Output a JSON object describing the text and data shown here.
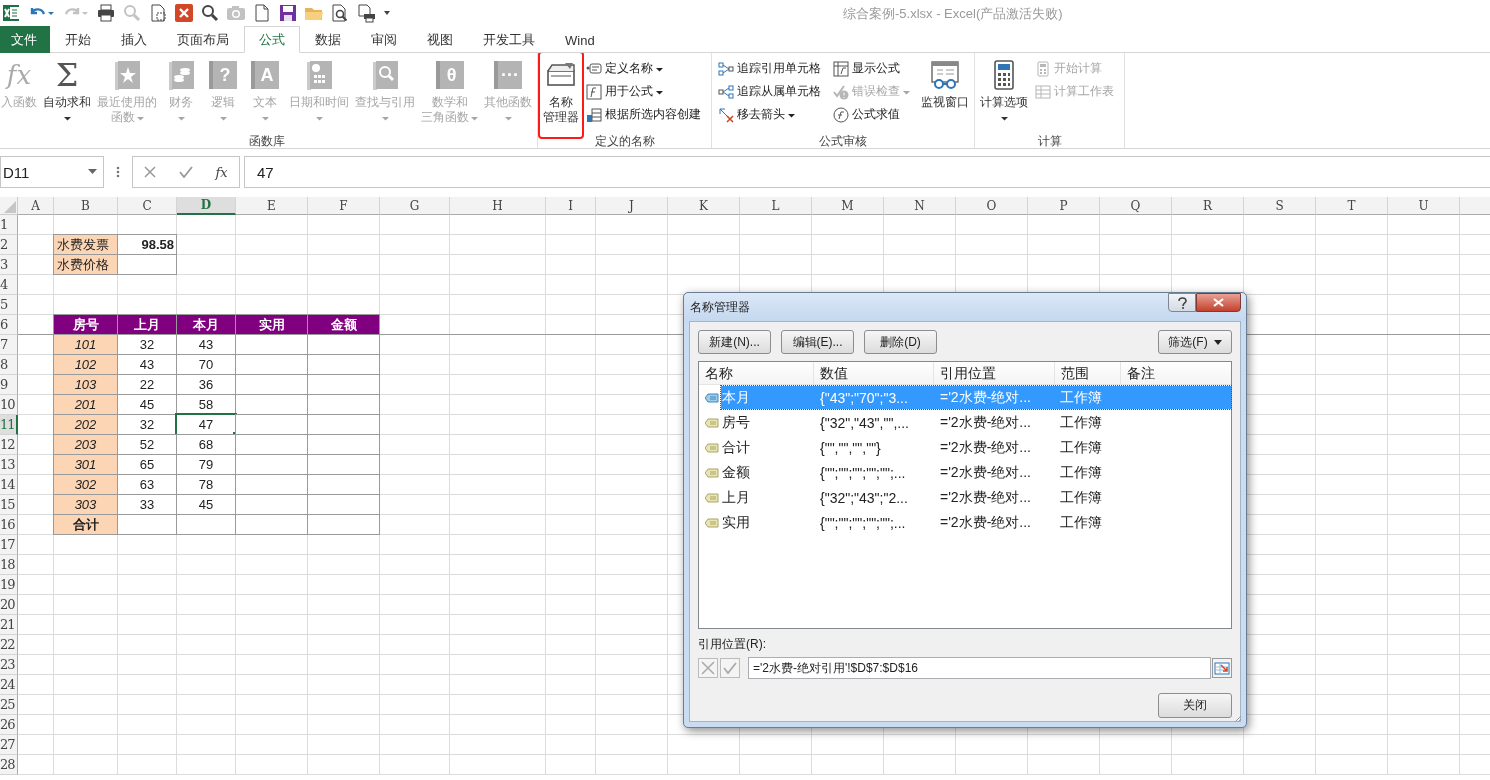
{
  "window": {
    "title": "综合案例-5.xlsx - Excel(产品激活失败)"
  },
  "quick_access": [
    {
      "disabled": false,
      "dropdown": false
    },
    {
      "disabled": false,
      "dropdown": true
    },
    {
      "disabled": true,
      "dropdown": true
    },
    {
      "disabled": false,
      "dropdown": false
    },
    {
      "disabled": true,
      "dropdown": false
    },
    {
      "disabled": false,
      "dropdown": false
    },
    {
      "disabled": false,
      "dropdown": false
    },
    {
      "disabled": false,
      "dropdown": false
    },
    {
      "disabled": true,
      "dropdown": false
    },
    {
      "disabled": false,
      "dropdown": false
    },
    {
      "disabled": false,
      "dropdown": false
    },
    {
      "disabled": false,
      "dropdown": false
    },
    {
      "disabled": false,
      "dropdown": false
    },
    {
      "disabled": false,
      "dropdown": false
    },
    {
      "disabled": false,
      "dropdown": true
    }
  ],
  "tabs": [
    {
      "label": "文件",
      "kind": "file",
      "selected": false
    },
    {
      "label": "开始",
      "kind": "tab",
      "selected": false
    },
    {
      "label": "插入",
      "kind": "tab",
      "selected": false
    },
    {
      "label": "页面布局",
      "kind": "tab",
      "selected": false
    },
    {
      "label": "公式",
      "kind": "tab",
      "selected": true
    },
    {
      "label": "数据",
      "kind": "tab",
      "selected": false
    },
    {
      "label": "审阅",
      "kind": "tab",
      "selected": false
    },
    {
      "label": "视图",
      "kind": "tab",
      "selected": false
    },
    {
      "label": "开发工具",
      "kind": "tab",
      "selected": false
    },
    {
      "label": "Wind",
      "kind": "tab",
      "selected": false
    }
  ],
  "ribbon": {
    "groups": [
      {
        "label": "函数库",
        "items": [
          {
            "kind": "large",
            "lines": [
              "入函数"
            ],
            "glyph": "fx",
            "dropdown": false,
            "disabled": true
          },
          {
            "kind": "large",
            "lines": [
              "自动求和"
            ],
            "glyph": "Σ",
            "dropdown": true,
            "disabled": false
          },
          {
            "kind": "large",
            "lines": [
              "最近使用的",
              "函数"
            ],
            "dropdown": true,
            "disabled": true
          },
          {
            "kind": "large",
            "lines": [
              "财务"
            ],
            "dropdown": true,
            "disabled": true
          },
          {
            "kind": "large",
            "lines": [
              "逻辑"
            ],
            "glyph": "?",
            "dropdown": true,
            "disabled": true
          },
          {
            "kind": "large",
            "lines": [
              "文本"
            ],
            "glyph": "A",
            "dropdown": true,
            "disabled": true
          },
          {
            "kind": "large",
            "lines": [
              "日期和时间"
            ],
            "dropdown": true,
            "disabled": true
          },
          {
            "kind": "large",
            "lines": [
              "查找与引用"
            ],
            "dropdown": true,
            "disabled": true
          },
          {
            "kind": "large",
            "lines": [
              "数学和",
              "三角函数"
            ],
            "glyph": "θ",
            "dropdown": true,
            "disabled": true
          },
          {
            "kind": "large",
            "lines": [
              "其他函数"
            ],
            "glyph": "···",
            "dropdown": true,
            "disabled": true
          }
        ]
      },
      {
        "label": "定义的名称",
        "items": [
          {
            "kind": "large",
            "lines": [
              "名称",
              "管理器"
            ],
            "dropdown": false,
            "disabled": false,
            "highlighted": true
          },
          {
            "kind": "stack",
            "items": [
              {
                "label": "定义名称",
                "dropdown": true,
                "disabled": false
              },
              {
                "label": "用于公式",
                "dropdown": true,
                "disabled": false
              },
              {
                "label": "根据所选内容创建",
                "dropdown": false,
                "disabled": false
              }
            ]
          }
        ]
      },
      {
        "label": "公式审核",
        "items": [
          {
            "kind": "stack",
            "items": [
              {
                "label": "追踪引用单元格",
                "dropdown": false,
                "disabled": false
              },
              {
                "label": "追踪从属单元格",
                "dropdown": false,
                "disabled": false
              },
              {
                "label": "移去箭头",
                "dropdown": true,
                "disabled": false
              }
            ]
          },
          {
            "kind": "stack",
            "items": [
              {
                "label": "显示公式",
                "dropdown": false,
                "disabled": false
              },
              {
                "label": "错误检查",
                "dropdown": true,
                "disabled": true
              },
              {
                "label": "公式求值",
                "dropdown": false,
                "disabled": false
              }
            ]
          },
          {
            "kind": "large",
            "lines": [
              "监视窗口"
            ],
            "dropdown": false,
            "disabled": false
          }
        ]
      },
      {
        "label": "计算",
        "items": [
          {
            "kind": "large",
            "lines": [
              "计算选项"
            ],
            "dropdown": true,
            "disabled": false
          },
          {
            "kind": "stack",
            "items": [
              {
                "label": "开始计算",
                "dropdown": false,
                "disabled": true
              },
              {
                "label": "计算工作表",
                "dropdown": false,
                "disabled": true
              }
            ]
          }
        ]
      }
    ]
  },
  "formula_bar": {
    "name_box": "D11",
    "fx": "fx",
    "formula": "47"
  },
  "sheet": {
    "columns": [
      {
        "label": "A",
        "selected": false
      },
      {
        "label": "B",
        "selected": false
      },
      {
        "label": "C",
        "selected": false
      },
      {
        "label": "D",
        "selected": true
      },
      {
        "label": "E",
        "selected": false
      },
      {
        "label": "F",
        "selected": false
      },
      {
        "label": "G",
        "selected": false
      },
      {
        "label": "H",
        "selected": false
      },
      {
        "label": "I",
        "selected": false
      },
      {
        "label": "J",
        "selected": false
      },
      {
        "label": "K",
        "selected": false
      },
      {
        "label": "L",
        "selected": false
      },
      {
        "label": "M",
        "selected": false
      },
      {
        "label": "N",
        "selected": false
      },
      {
        "label": "O",
        "selected": false
      },
      {
        "label": "P",
        "selected": false
      },
      {
        "label": "Q",
        "selected": false
      },
      {
        "label": "R",
        "selected": false
      },
      {
        "label": "S",
        "selected": false
      },
      {
        "label": "T",
        "selected": false
      },
      {
        "label": "U",
        "selected": false
      }
    ],
    "rows": [
      {
        "label": "1",
        "selected": false
      },
      {
        "label": "2",
        "selected": false
      },
      {
        "label": "3",
        "selected": false
      },
      {
        "label": "4",
        "selected": false
      },
      {
        "label": "5",
        "selected": false
      },
      {
        "label": "6",
        "selected": false
      },
      {
        "label": "7",
        "selected": false
      },
      {
        "label": "8",
        "selected": false
      },
      {
        "label": "9",
        "selected": false
      },
      {
        "label": "10",
        "selected": false
      },
      {
        "label": "11",
        "selected": true
      },
      {
        "label": "12",
        "selected": false
      },
      {
        "label": "13",
        "selected": false
      },
      {
        "label": "14",
        "selected": false
      },
      {
        "label": "15",
        "selected": false
      },
      {
        "label": "16",
        "selected": false
      },
      {
        "label": "17",
        "selected": false
      },
      {
        "label": "18",
        "selected": false
      },
      {
        "label": "19",
        "selected": false
      },
      {
        "label": "20",
        "selected": false
      },
      {
        "label": "21",
        "selected": false
      },
      {
        "label": "22",
        "selected": false
      },
      {
        "label": "23",
        "selected": false
      },
      {
        "label": "24",
        "selected": false
      },
      {
        "label": "25",
        "selected": false
      },
      {
        "label": "26",
        "selected": false
      },
      {
        "label": "27",
        "selected": false
      },
      {
        "label": "28",
        "selected": false
      }
    ],
    "invoice": [
      {
        "label": "水费发票",
        "value": "98.58"
      },
      {
        "label": "水费价格"
      }
    ],
    "rent_table": {
      "headers": [
        "房号",
        "上月",
        "本月",
        "实用",
        "金额"
      ],
      "rows": [
        {
          "room": "101",
          "last": "32",
          "current": "43"
        },
        {
          "room": "102",
          "last": "43",
          "current": "70"
        },
        {
          "room": "103",
          "last": "22",
          "current": "36"
        },
        {
          "room": "201",
          "last": "45",
          "current": "58"
        },
        {
          "room": "202",
          "last": "32",
          "current": "47"
        },
        {
          "room": "203",
          "last": "52",
          "current": "68"
        },
        {
          "room": "301",
          "last": "65",
          "current": "79"
        },
        {
          "room": "302",
          "last": "63",
          "current": "78"
        },
        {
          "room": "303",
          "last": "33",
          "current": "45"
        }
      ],
      "total_label": "合计"
    }
  },
  "dialog": {
    "title": "名称管理器",
    "buttons": [
      "新建(N)...",
      "编辑(E)...",
      "删除(D)"
    ],
    "filter": "筛选(F)",
    "columns": [
      "名称",
      "数值",
      "引用位置",
      "范围",
      "备注"
    ],
    "names": [
      {
        "name": "本月",
        "value": "{\"43\";\"70\";\"3...",
        "refers_to": "='2水费-绝对...",
        "scope": "工作簿",
        "selected": true
      },
      {
        "name": "房号",
        "value": "{\"32\",\"43\",\"\",...",
        "refers_to": "='2水费-绝对...",
        "scope": "工作簿",
        "selected": false
      },
      {
        "name": "合计",
        "value": "{\"\",\"\",\"\",\"\"}",
        "refers_to": "='2水费-绝对...",
        "scope": "工作簿",
        "selected": false
      },
      {
        "name": "金额",
        "value": "{\"\";\"\";\"\";\"\";\"\";...",
        "refers_to": "='2水费-绝对...",
        "scope": "工作簿",
        "selected": false
      },
      {
        "name": "上月",
        "value": "{\"32\";\"43\";\"2...",
        "refers_to": "='2水费-绝对...",
        "scope": "工作簿",
        "selected": false
      },
      {
        "name": "实用",
        "value": "{\"\";\"\";\"\";\"\";\"\";...",
        "refers_to": "='2水费-绝对...",
        "scope": "工作簿",
        "selected": false
      }
    ],
    "refers_label": "引用位置(R):",
    "refers_value": "='2水费-绝对引用'!$D$7:$D$16",
    "close": "关闭"
  }
}
